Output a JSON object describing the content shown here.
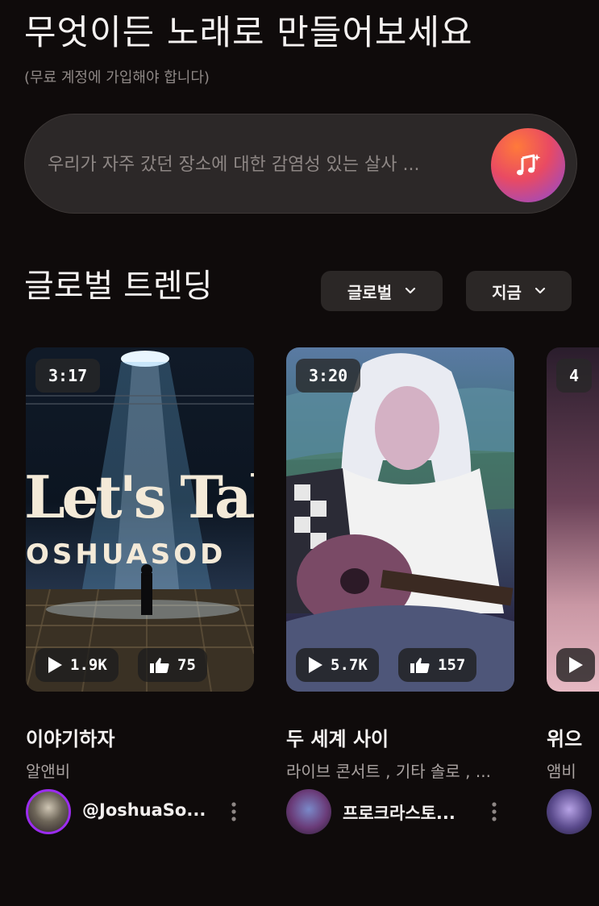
{
  "hero": {
    "title": "무엇이든 노래로 만들어보세요",
    "subtitle": "(무료 계정에 가입해야 합니다)"
  },
  "prompt": {
    "placeholder": "우리가 자주 갔던 장소에 대한 감염성 있는 살사 ...",
    "create_icon": "music-note-sparkle-icon"
  },
  "trending": {
    "title": "글로벌 트렌딩",
    "filters": [
      {
        "label": "글로벌"
      },
      {
        "label": "지금"
      }
    ],
    "tracks": [
      {
        "duration": "3:17",
        "cover_text_1": "Let's Talk",
        "cover_text_2": "OSHUASOD",
        "plays": "1.9K",
        "likes": "75",
        "title": "이야기하자",
        "tags": "알앤비",
        "author": "@JoshuaSo..."
      },
      {
        "duration": "3:20",
        "plays": "5.7K",
        "likes": "157",
        "title": "두 세계 사이",
        "tags": "라이브 콘서트 , 기타 솔로 , ...",
        "author": "프로크라스토..."
      },
      {
        "duration": "4",
        "title": "위으",
        "tags": "앰비"
      }
    ]
  },
  "colors": {
    "background": "#0f0b0b",
    "surface": "#2c2828",
    "accent_gradient_start": "#ff7a3a",
    "accent_gradient_end": "#8a4bd8",
    "avatar_ring": "#9b2cf0"
  }
}
